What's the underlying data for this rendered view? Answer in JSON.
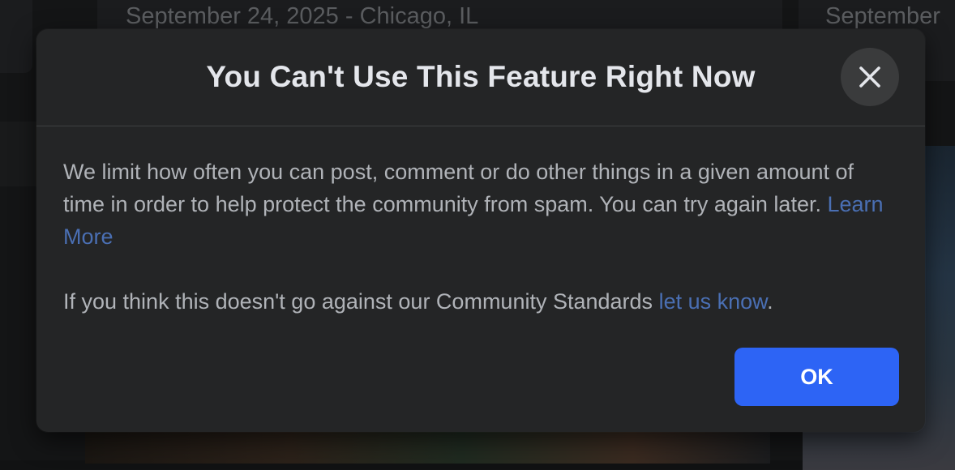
{
  "background": {
    "center_date": "September 24, 2025 - Chicago, IL",
    "right_date": "September"
  },
  "dialog": {
    "title": "You Can't Use This Feature Right Now",
    "close_icon": "close-icon",
    "paragraph1_text": "We limit how often you can post, comment or do other things in a given amount of time in order to help protect the community from spam. You can try again later.",
    "paragraph1_link": "Learn More",
    "paragraph2_text": "If you think this doesn't go against our Community Standards",
    "paragraph2_link": "let us know",
    "paragraph2_end": ".",
    "ok_label": "OK"
  },
  "colors": {
    "modal_bg": "#242526",
    "link": "#4a6fb3",
    "primary_button": "#2d64f5"
  }
}
